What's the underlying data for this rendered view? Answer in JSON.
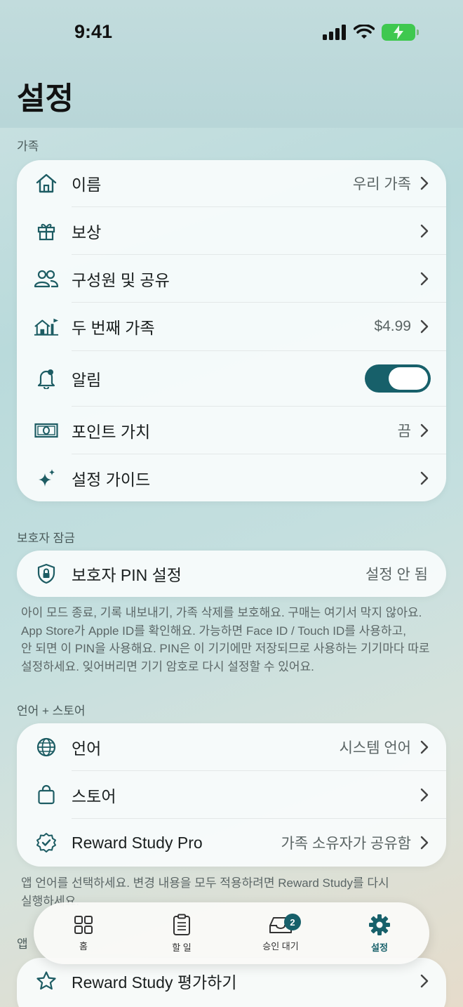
{
  "status": {
    "time": "9:41"
  },
  "page_title": "설정",
  "family": {
    "section_label": "가족",
    "rows": [
      {
        "icon": "house-icon",
        "label": "이름",
        "value": "우리 가족"
      },
      {
        "icon": "gift-icon",
        "label": "보상",
        "value": ""
      },
      {
        "icon": "people-icon",
        "label": "구성원 및 공유",
        "value": ""
      },
      {
        "icon": "second-house-icon",
        "label": "두 번째 가족",
        "value": "$4.99"
      },
      {
        "icon": "bell-icon",
        "label": "알림",
        "toggle_on": true
      },
      {
        "icon": "banknote-icon",
        "label": "포인트 가치",
        "value": "끔"
      },
      {
        "icon": "sparkles-icon",
        "label": "설정 가이드",
        "value": ""
      }
    ]
  },
  "parent_lock": {
    "section_label": "보호자 잠금",
    "row": {
      "icon": "lock-shield-icon",
      "label": "보호자 PIN 설정",
      "value": "설정 안 됨"
    },
    "footnote_lines": [
      "아이 모드 종료, 기록 내보내기, 가족 삭제를 보호해요. 구매는 여기서 막지 않아요.",
      "App Store가 Apple ID를 확인해요. 가능하면 Face ID / Touch ID를 사용하고,",
      "안 되면 이 PIN을 사용해요. PIN은 이 기기에만 저장되므로 사용하는 기기마다 따로",
      "설정하세요. 잊어버리면 기기 암호로 다시 설정할 수 있어요."
    ]
  },
  "language_store": {
    "section_label": "언어 + 스토어",
    "rows": [
      {
        "icon": "globe-icon",
        "label": "언어",
        "value": "시스템 언어"
      },
      {
        "icon": "bag-icon",
        "label": "스토어",
        "value": ""
      },
      {
        "icon": "seal-check-icon",
        "label": "Reward Study Pro",
        "value": "가족 소유자가 공유함"
      }
    ],
    "footnote_lines": [
      "앱 언어를 선택하세요. 변경 내용을 모두 적용하려면 Reward Study를 다시",
      "실행하세요."
    ]
  },
  "app_section": {
    "section_label": "앱",
    "rows": [
      {
        "icon": "star-icon",
        "label": "Reward Study 평가하기",
        "value": ""
      }
    ]
  },
  "tabbar": {
    "tabs": [
      {
        "label": "홈",
        "icon": "grid-icon"
      },
      {
        "label": "할 일",
        "icon": "clipboard-icon"
      },
      {
        "label": "승인 대기",
        "icon": "tray-icon",
        "badge": "2"
      },
      {
        "label": "설정",
        "icon": "gear-icon",
        "active": true
      }
    ]
  },
  "colors": {
    "accent": "#17606a",
    "battery": "#3fc84f"
  }
}
